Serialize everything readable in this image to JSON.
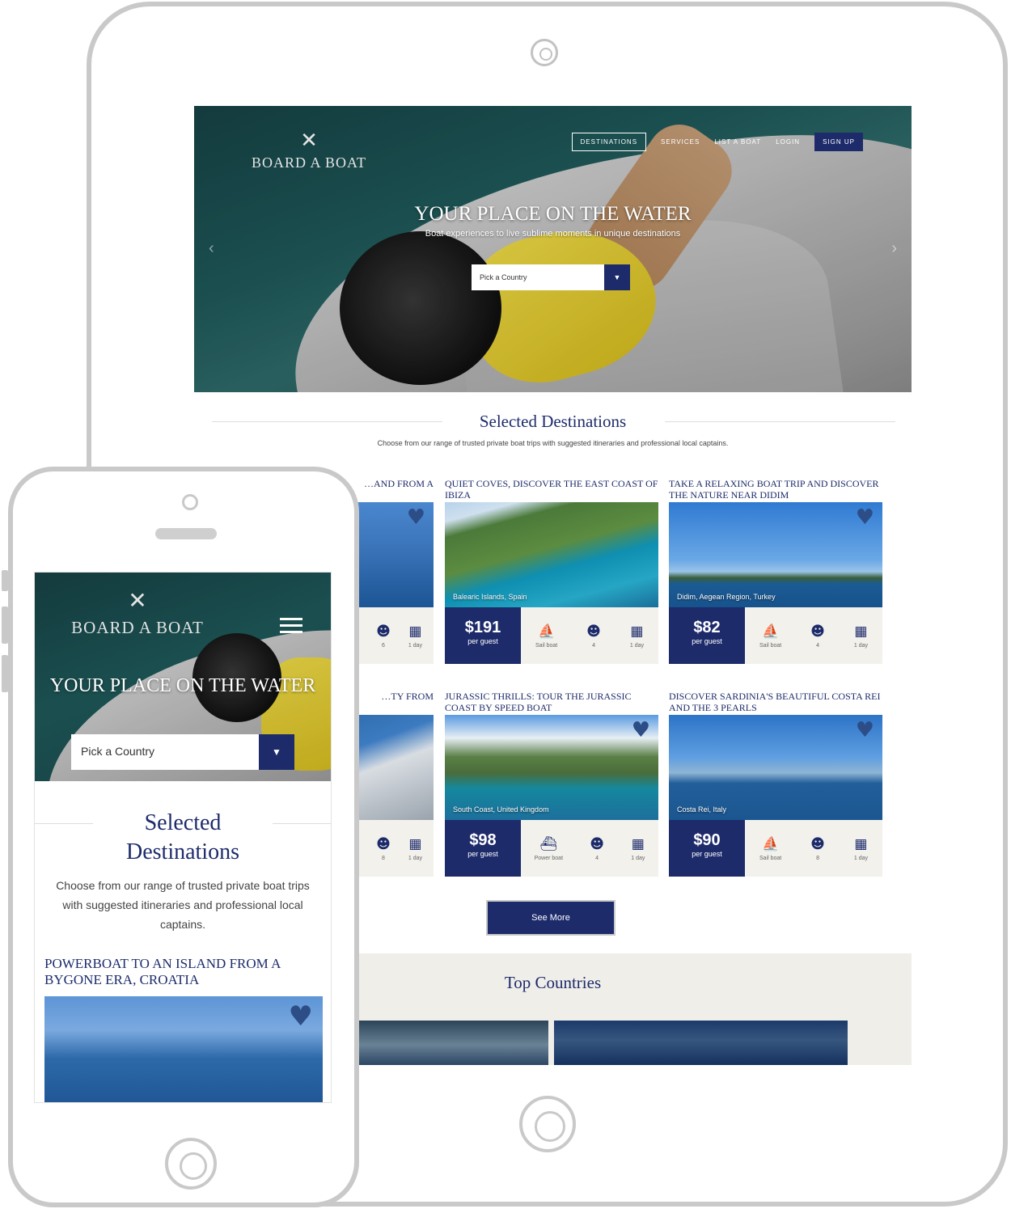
{
  "brand": {
    "name": "BOARD A BOAT"
  },
  "tablet": {
    "nav": [
      "DESTINATIONS",
      "SERVICES",
      "LIST A BOAT",
      "LOGIN",
      "SIGN UP"
    ],
    "hero_title": "YOUR PLACE ON THE WATER",
    "hero_subtitle": "Boat experiences to live sublime moments in unique destinations",
    "pick_placeholder": "Pick a Country",
    "section_title": "Selected Destinations",
    "section_subtitle": "Choose from our range of trusted private boat trips with suggested itineraries and professional local captains.",
    "cards": [
      {
        "title": "…AND FROM A",
        "location": "",
        "price": "",
        "per": "",
        "features": [
          {
            "icon": "captain-icon",
            "label": "6"
          },
          {
            "icon": "calendar-icon",
            "label": "1 day"
          }
        ]
      },
      {
        "title": "QUIET COVES, DISCOVER THE EAST COAST OF IBIZA",
        "location": "Balearic Islands, Spain",
        "price": "$191",
        "per": "per guest",
        "features": [
          {
            "icon": "sailboat-icon",
            "label": "Sail boat"
          },
          {
            "icon": "captain-icon",
            "label": "4"
          },
          {
            "icon": "calendar-icon",
            "label": "1 day"
          }
        ]
      },
      {
        "title": "TAKE A RELAXING BOAT TRIP AND DISCOVER THE NATURE NEAR DIDIM",
        "location": "Didim, Aegean Region, Turkey",
        "price": "$82",
        "per": "per guest",
        "features": [
          {
            "icon": "sailboat-icon",
            "label": "Sail boat"
          },
          {
            "icon": "captain-icon",
            "label": "4"
          },
          {
            "icon": "calendar-icon",
            "label": "1 day"
          }
        ]
      },
      {
        "title": "…TY FROM",
        "location": "",
        "price": "",
        "per": "",
        "features": [
          {
            "icon": "captain-icon",
            "label": "8"
          },
          {
            "icon": "calendar-icon",
            "label": "1 day"
          }
        ]
      },
      {
        "title": "JURASSIC THRILLS: TOUR THE JURASSIC COAST BY SPEED BOAT",
        "location": "South Coast, United Kingdom",
        "price": "$98",
        "per": "per guest",
        "features": [
          {
            "icon": "powerboat-icon",
            "label": "Power boat"
          },
          {
            "icon": "captain-icon",
            "label": "4"
          },
          {
            "icon": "calendar-icon",
            "label": "1 day"
          }
        ]
      },
      {
        "title": "DISCOVER SARDINIA'S BEAUTIFUL COSTA REI AND THE 3 PEARLS",
        "location": "Costa Rei, Italy",
        "price": "$90",
        "per": "per guest",
        "features": [
          {
            "icon": "sailboat-icon",
            "label": "Sail boat"
          },
          {
            "icon": "captain-icon",
            "label": "8"
          },
          {
            "icon": "calendar-icon",
            "label": "1 day"
          }
        ]
      }
    ],
    "see_more": "See More",
    "top_countries": "Top Countries"
  },
  "phone": {
    "hero_title": "YOUR PLACE ON THE WATER",
    "pick_placeholder": "Pick a Country",
    "section_title": "Selected Destinations",
    "section_subtitle": "Choose from our range of trusted private boat trips with suggested itineraries and professional local captains.",
    "card_title": "POWERBOAT TO AN ISLAND FROM A BYGONE ERA, CROATIA"
  },
  "icons": {
    "heart": "heart-icon",
    "logo": "crossed-oars-icon",
    "menu": "hamburger-menu-icon",
    "dropdown": "chevron-down-icon"
  },
  "colors": {
    "brand_navy": "#1d2b6b",
    "card_footer": "#f2f1ec",
    "band": "#efeee9"
  }
}
